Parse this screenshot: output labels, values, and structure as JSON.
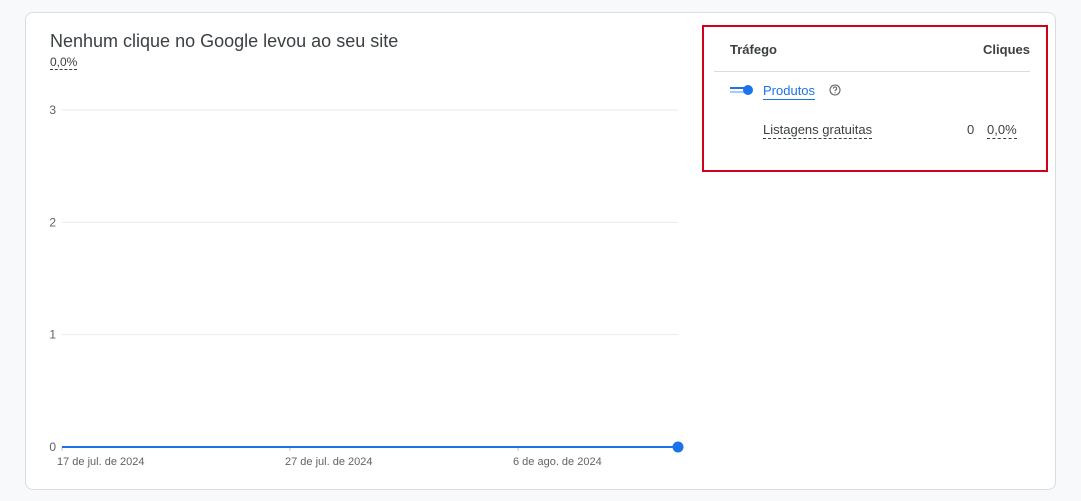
{
  "chart_title": "Nenhum clique no Google levou ao seu site",
  "chart_subtitle": "0,0%",
  "table": {
    "col_traffic": "Tráfego",
    "col_clicks": "Cliques",
    "group_label": "Produtos",
    "help_icon": "help-circle-icon",
    "row": {
      "label": "Listagens gratuitas",
      "clicks": "0",
      "percent": "0,0%"
    }
  },
  "colors": {
    "series": "#1a73e8",
    "highlight_border": "#d0021b",
    "grid": "#e8eaed"
  },
  "chart_data": {
    "type": "line",
    "x_tick_labels": [
      "17 de jul. de 2024",
      "27 de jul. de 2024",
      "6 de ago. de 2024"
    ],
    "y_ticks": [
      0,
      1,
      2,
      3
    ],
    "ylim": [
      0,
      3
    ],
    "grid": true,
    "series": [
      {
        "values": [
          0,
          0
        ],
        "end_marker": true
      }
    ]
  }
}
